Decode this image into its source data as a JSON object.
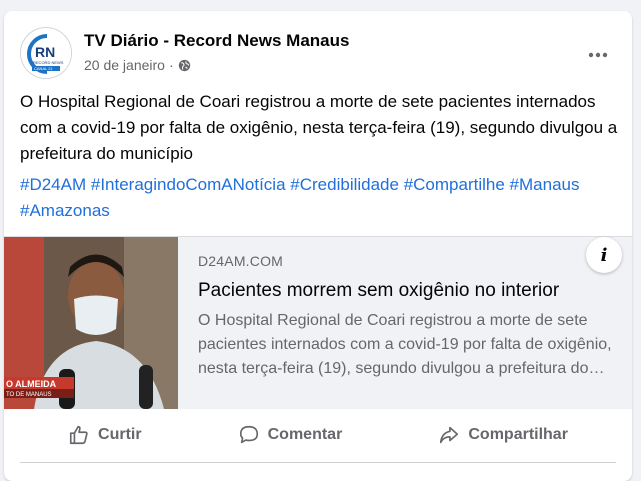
{
  "post": {
    "page_name": "TV Diário - Record News Manaus",
    "date": "20 de janeiro",
    "audience_icon": "globe-icon",
    "text": "O Hospital Regional de Coari registrou a morte de sete pacientes internados com a covid-19 por falta de oxigênio, nesta terça-feira (19), segundo divulgou a prefeitura do município",
    "hashtags": [
      "#D24AM",
      "#InteragindoComANotícia",
      "#Credibilidade",
      "#Compartilhe",
      "#Manaus",
      "#Amazonas"
    ]
  },
  "avatar": {
    "logo_text": "RN",
    "subtext": "RECORD NEWS",
    "badge": "CANAL 21"
  },
  "link_preview": {
    "domain": "D24AM.COM",
    "title": "Pacientes morrem sem oxigênio no interior",
    "description": "O Hospital Regional de Coari registrou a morte de sete pacientes internados com a covid-19 por falta de oxigênio, nesta terça-feira (19), segundo divulgou a prefeitura do município",
    "thumb_caption_1": "O ALMEIDA",
    "thumb_caption_2": "TO DE MANAUS"
  },
  "actions": {
    "like": "Curtir",
    "comment": "Comentar",
    "share": "Compartilhar"
  },
  "colors": {
    "link": "#216fdb",
    "secondary_text": "#65676b",
    "card_bg": "#ffffff",
    "page_bg": "#f0f2f5"
  }
}
